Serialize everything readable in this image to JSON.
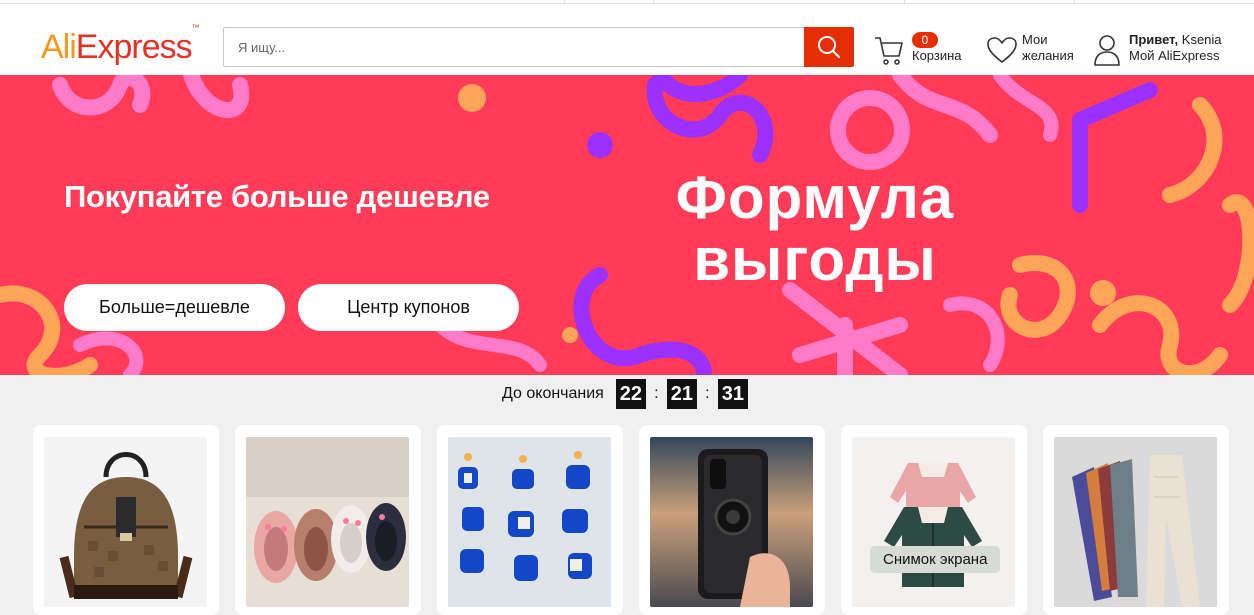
{
  "header": {
    "logo_text_a": "Ali",
    "logo_text_b": "Express",
    "logo_tm": "™",
    "search_placeholder": "Я ищу...",
    "cart": {
      "count": "0",
      "label": "Корзина"
    },
    "wishlist": {
      "line1": "Мои",
      "line2": "желания"
    },
    "account": {
      "greeting": "Привет,",
      "name": "Ksenia",
      "link": "Мой AliExpress"
    }
  },
  "banner": {
    "subtitle": "Покупайте больше дешевле",
    "title_line1": "Формула",
    "title_line2": "выгоды",
    "buttons": [
      "Больше=дешевле",
      "Центр купонов"
    ],
    "color": "#ff3b57"
  },
  "countdown": {
    "label": "До окончания",
    "hours": "22",
    "minutes": "21",
    "seconds": "31"
  },
  "products": [
    {
      "image": "backpack-image"
    },
    {
      "image": "kids-shoes-image"
    },
    {
      "image": "earrings-image"
    },
    {
      "image": "phone-case-image"
    },
    {
      "image": "kids-jackets-image"
    },
    {
      "image": "leggings-image"
    }
  ],
  "tooltip": {
    "text": "Снимок экрана"
  },
  "colors": {
    "accent": "#e62e04",
    "brand_orange": "#f7971d",
    "brand_red": "#e43225"
  }
}
